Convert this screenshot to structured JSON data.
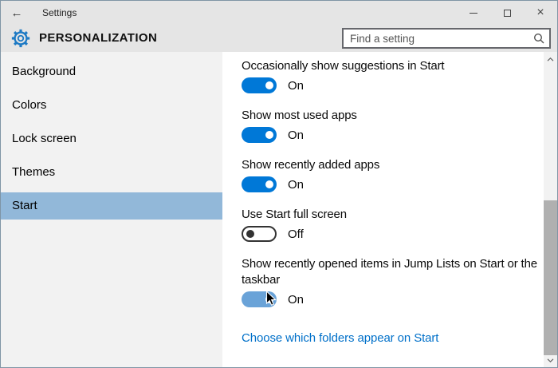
{
  "window": {
    "title": "Settings"
  },
  "header": {
    "title": "PERSONALIZATION",
    "search_placeholder": "Find a setting"
  },
  "sidebar": {
    "items": [
      {
        "label": "Background",
        "selected": false
      },
      {
        "label": "Colors",
        "selected": false
      },
      {
        "label": "Lock screen",
        "selected": false
      },
      {
        "label": "Themes",
        "selected": false
      },
      {
        "label": "Start",
        "selected": true
      }
    ]
  },
  "main": {
    "settings": [
      {
        "label": "Occasionally show suggestions in Start",
        "state": "On",
        "on": true,
        "hovered": false
      },
      {
        "label": "Show most used apps",
        "state": "On",
        "on": true,
        "hovered": false
      },
      {
        "label": "Show recently added apps",
        "state": "On",
        "on": true,
        "hovered": false
      },
      {
        "label": "Use Start full screen",
        "state": "Off",
        "on": false,
        "hovered": false
      },
      {
        "label": "Show recently opened items in Jump Lists on Start or the taskbar",
        "state": "On",
        "on": true,
        "hovered": true
      }
    ],
    "link": "Choose which folders appear on Start"
  },
  "icons": {
    "back": "left-arrow",
    "minimize": "horizontal-bar",
    "maximize": "square-outline",
    "close": "x-mark",
    "gear": "blue-outline-gear",
    "search": "magnifier",
    "scroll_up": "chevron-up",
    "scroll_down": "chevron-down",
    "cursor": "arrow-pointer"
  },
  "colors": {
    "accent_toggle_on": "#0078d7",
    "toggle_hover": "#6aa3d8",
    "selected_nav_bg": "#92b8d9",
    "link": "#0070c9",
    "titlebar_bg": "#e5e5e5",
    "sidebar_bg": "#f2f2f2",
    "window_border": "#7f95a5",
    "scrollbar_thumb": "#b0b0b0"
  }
}
